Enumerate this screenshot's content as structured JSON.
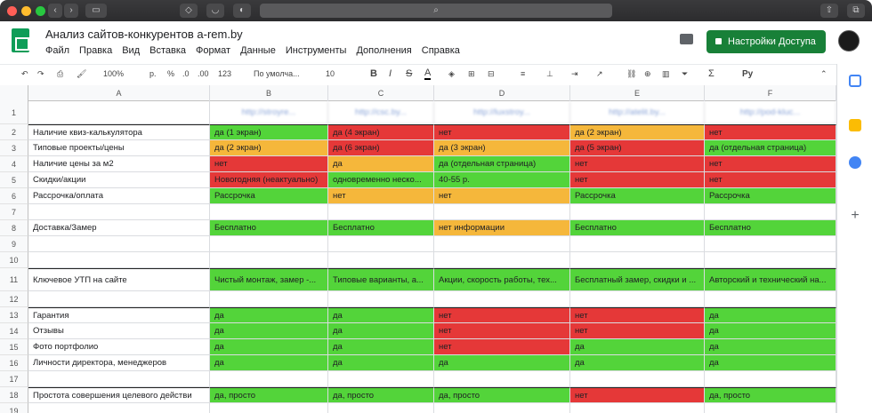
{
  "doc": {
    "title": "Анализ сайтов-конкурентов a-rem.by",
    "menu": [
      "Файл",
      "Правка",
      "Вид",
      "Вставка",
      "Формат",
      "Данные",
      "Инструменты",
      "Дополнения",
      "Справка"
    ],
    "share_label": "Настройки Доступа"
  },
  "toolbar": {
    "zoom": "100%",
    "currency": "р.",
    "percent": "%",
    "dec0": ".0",
    "dec00": ".00",
    "format123": "123",
    "font": "По умолча...",
    "size": "10",
    "bold": "B",
    "italic": "I",
    "strike": "S",
    "textcolor": "A",
    "sigma": "Σ",
    "lang": "Ру"
  },
  "columns": [
    "A",
    "B",
    "C",
    "D",
    "E",
    "F"
  ],
  "rows": [
    {
      "n": "1",
      "cells": [
        {
          "t": "",
          "c": ""
        },
        {
          "t": "http://stroyre...",
          "c": "url"
        },
        {
          "t": "http://csc.by...",
          "c": "url"
        },
        {
          "t": "http://luxstroy...",
          "c": "url"
        },
        {
          "t": "http://atelit.by...",
          "c": "url"
        },
        {
          "t": "http://pod-kluc...",
          "c": "url"
        }
      ]
    },
    {
      "n": "2",
      "cells": [
        {
          "t": "Наличие квиз-калькулятора",
          "c": ""
        },
        {
          "t": "да (1 экран)",
          "c": "green"
        },
        {
          "t": "да (4 экран)",
          "c": "red"
        },
        {
          "t": "нет",
          "c": "red"
        },
        {
          "t": "да (2 экран)",
          "c": "orange"
        },
        {
          "t": "нет",
          "c": "red"
        }
      ]
    },
    {
      "n": "3",
      "cells": [
        {
          "t": "Типовые проекты/цены",
          "c": ""
        },
        {
          "t": "да (2 экран)",
          "c": "orange"
        },
        {
          "t": "да (6 экран)",
          "c": "red"
        },
        {
          "t": "да (3 экран)",
          "c": "orange"
        },
        {
          "t": "да (5 экран)",
          "c": "red"
        },
        {
          "t": "да (отдельная страница)",
          "c": "green"
        }
      ]
    },
    {
      "n": "4",
      "cells": [
        {
          "t": "Наличие цены за м2",
          "c": ""
        },
        {
          "t": "нет",
          "c": "red"
        },
        {
          "t": "да",
          "c": "orange"
        },
        {
          "t": "да (отдельная страница)",
          "c": "green"
        },
        {
          "t": "нет",
          "c": "red"
        },
        {
          "t": "нет",
          "c": "red"
        }
      ]
    },
    {
      "n": "5",
      "cells": [
        {
          "t": "Скидки/акции",
          "c": ""
        },
        {
          "t": "Новогодняя (неактуально)",
          "c": "red"
        },
        {
          "t": "одновременно неско...",
          "c": "green"
        },
        {
          "t": "40-55 р.",
          "c": "green"
        },
        {
          "t": "нет",
          "c": "red"
        },
        {
          "t": "нет",
          "c": "red"
        }
      ]
    },
    {
      "n": "6",
      "cells": [
        {
          "t": "Рассрочка/оплата",
          "c": ""
        },
        {
          "t": "Рассрочка",
          "c": "green"
        },
        {
          "t": "нет",
          "c": "orange"
        },
        {
          "t": "нет",
          "c": "orange"
        },
        {
          "t": "Рассрочка",
          "c": "green"
        },
        {
          "t": "Рассрочка",
          "c": "green"
        }
      ]
    },
    {
      "n": "7",
      "cells": [
        {
          "t": "",
          "c": ""
        },
        {
          "t": "",
          "c": ""
        },
        {
          "t": "",
          "c": ""
        },
        {
          "t": "",
          "c": ""
        },
        {
          "t": "",
          "c": ""
        },
        {
          "t": "",
          "c": ""
        }
      ]
    },
    {
      "n": "8",
      "cells": [
        {
          "t": "Доставка/Замер",
          "c": ""
        },
        {
          "t": "Бесплатно",
          "c": "green"
        },
        {
          "t": "Бесплатно",
          "c": "green"
        },
        {
          "t": "нет информации",
          "c": "orange"
        },
        {
          "t": "Бесплатно",
          "c": "green"
        },
        {
          "t": "Бесплатно",
          "c": "green"
        }
      ]
    },
    {
      "n": "9",
      "cells": [
        {
          "t": "",
          "c": ""
        },
        {
          "t": "",
          "c": ""
        },
        {
          "t": "",
          "c": ""
        },
        {
          "t": "",
          "c": ""
        },
        {
          "t": "",
          "c": ""
        },
        {
          "t": "",
          "c": ""
        }
      ]
    },
    {
      "n": "10",
      "cells": [
        {
          "t": "",
          "c": ""
        },
        {
          "t": "",
          "c": ""
        },
        {
          "t": "",
          "c": ""
        },
        {
          "t": "",
          "c": ""
        },
        {
          "t": "",
          "c": ""
        },
        {
          "t": "",
          "c": ""
        }
      ]
    },
    {
      "n": "11",
      "cells": [
        {
          "t": "Ключевое УТП на сайте",
          "c": ""
        },
        {
          "t": "Чистый монтаж, замер -...",
          "c": "green"
        },
        {
          "t": "Типовые варианты, а...",
          "c": "green"
        },
        {
          "t": "Акции, скорость работы, тех...",
          "c": "green"
        },
        {
          "t": "Бесплатный замер, скидки и ...",
          "c": "green"
        },
        {
          "t": "Авторский и технический на...",
          "c": "green"
        }
      ]
    },
    {
      "n": "12",
      "cells": [
        {
          "t": "",
          "c": ""
        },
        {
          "t": "",
          "c": ""
        },
        {
          "t": "",
          "c": ""
        },
        {
          "t": "",
          "c": ""
        },
        {
          "t": "",
          "c": ""
        },
        {
          "t": "",
          "c": ""
        }
      ]
    },
    {
      "n": "13",
      "cells": [
        {
          "t": "Гарантия",
          "c": ""
        },
        {
          "t": "да",
          "c": "green"
        },
        {
          "t": "да",
          "c": "green"
        },
        {
          "t": "нет",
          "c": "red"
        },
        {
          "t": "нет",
          "c": "red"
        },
        {
          "t": "да",
          "c": "green"
        }
      ]
    },
    {
      "n": "14",
      "cells": [
        {
          "t": "Отзывы",
          "c": ""
        },
        {
          "t": "да",
          "c": "green"
        },
        {
          "t": "да",
          "c": "green"
        },
        {
          "t": "нет",
          "c": "red"
        },
        {
          "t": "нет",
          "c": "red"
        },
        {
          "t": "да",
          "c": "green"
        }
      ]
    },
    {
      "n": "15",
      "cells": [
        {
          "t": "Фото портфолио",
          "c": ""
        },
        {
          "t": "да",
          "c": "green"
        },
        {
          "t": "да",
          "c": "green"
        },
        {
          "t": "нет",
          "c": "red"
        },
        {
          "t": "да",
          "c": "green"
        },
        {
          "t": "да",
          "c": "green"
        }
      ]
    },
    {
      "n": "16",
      "cells": [
        {
          "t": "Личности директора, менеджеров",
          "c": ""
        },
        {
          "t": "да",
          "c": "green"
        },
        {
          "t": "да",
          "c": "green"
        },
        {
          "t": "да",
          "c": "green"
        },
        {
          "t": "да",
          "c": "green"
        },
        {
          "t": "да",
          "c": "green"
        }
      ]
    },
    {
      "n": "17",
      "cells": [
        {
          "t": "",
          "c": ""
        },
        {
          "t": "",
          "c": ""
        },
        {
          "t": "",
          "c": ""
        },
        {
          "t": "",
          "c": ""
        },
        {
          "t": "",
          "c": ""
        },
        {
          "t": "",
          "c": ""
        }
      ]
    },
    {
      "n": "18",
      "cells": [
        {
          "t": "Простота совершения целевого действи",
          "c": ""
        },
        {
          "t": "да, просто",
          "c": "green"
        },
        {
          "t": "да, просто",
          "c": "green"
        },
        {
          "t": "да, просто",
          "c": "green"
        },
        {
          "t": "нет",
          "c": "red"
        },
        {
          "t": "да, просто",
          "c": "green"
        }
      ]
    },
    {
      "n": "19",
      "cells": [
        {
          "t": "",
          "c": ""
        },
        {
          "t": "",
          "c": ""
        },
        {
          "t": "",
          "c": ""
        },
        {
          "t": "",
          "c": ""
        },
        {
          "t": "",
          "c": ""
        },
        {
          "t": "",
          "c": ""
        }
      ]
    }
  ],
  "colors": {
    "green": "#53d43a",
    "red": "#e53838",
    "orange": "#f5b73b",
    "brand": "#188038"
  }
}
